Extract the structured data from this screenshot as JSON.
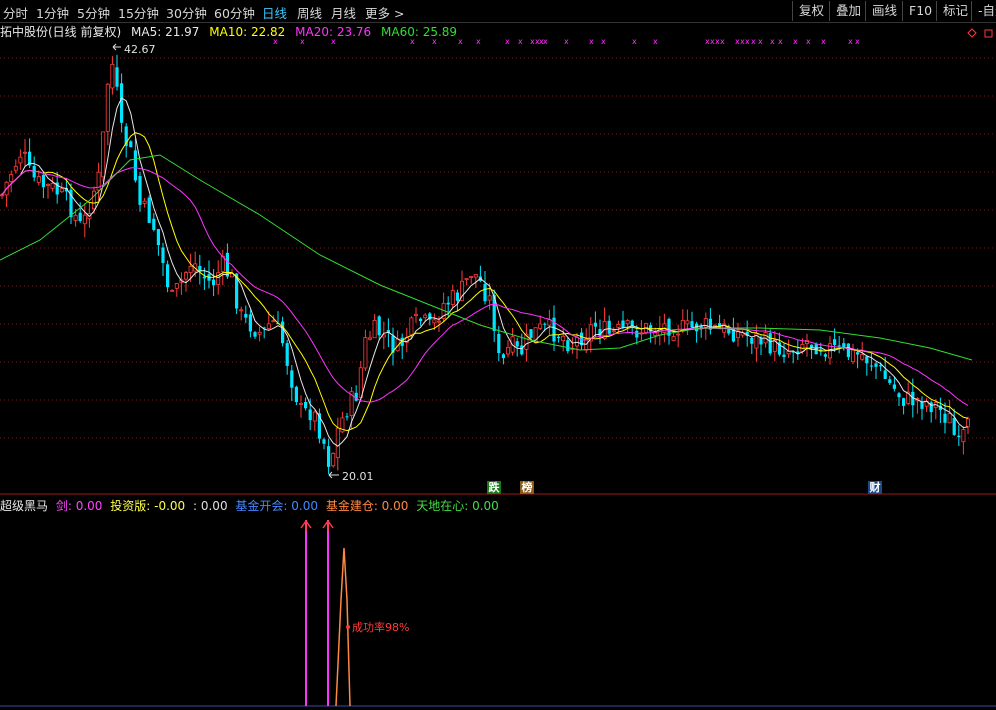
{
  "toolbar": {
    "tabs": [
      "分时",
      "1分钟",
      "5分钟",
      "15分钟",
      "30分钟",
      "60分钟",
      "日线",
      "周线",
      "月线",
      "更多 >"
    ],
    "active_tab": "日线",
    "buttons": [
      "复权",
      "叠加",
      "画线",
      "F10",
      "标记",
      "-自选"
    ]
  },
  "stock": {
    "title": "拓中股份(日线 前复权)",
    "ma5": "MA5: 21.97",
    "ma10": "MA10: 22.82",
    "ma20": "MA20: 23.76",
    "ma60": "MA60: 25.89",
    "high_label": "42.67",
    "low_label": "20.01",
    "event_tags": [
      "跌",
      "榜",
      "财"
    ]
  },
  "indicator": {
    "name": "超级黑马",
    "items": [
      {
        "label": "剑: 0.00",
        "color": "#ff44ff"
      },
      {
        "label": "投资版: -0.00",
        "color": "#ffff44"
      },
      {
        "label": ": 0.00",
        "color": "#e0e0e0"
      },
      {
        "label": "基金开会: 0.00",
        "color": "#4488ff"
      },
      {
        "label": "基金建仓: 0.00",
        "color": "#ff8844"
      },
      {
        "label": "天地在心: 0.00",
        "color": "#44dd44"
      }
    ],
    "annotation": "成功率98%"
  },
  "colors": {
    "up": "#ff3c3c",
    "down": "#00e5ff",
    "ma5": "#e8e8e8",
    "ma10": "#ffff00",
    "ma20": "#ff33ff",
    "ma60": "#33dd33",
    "grid": "#7a1a1a"
  }
}
